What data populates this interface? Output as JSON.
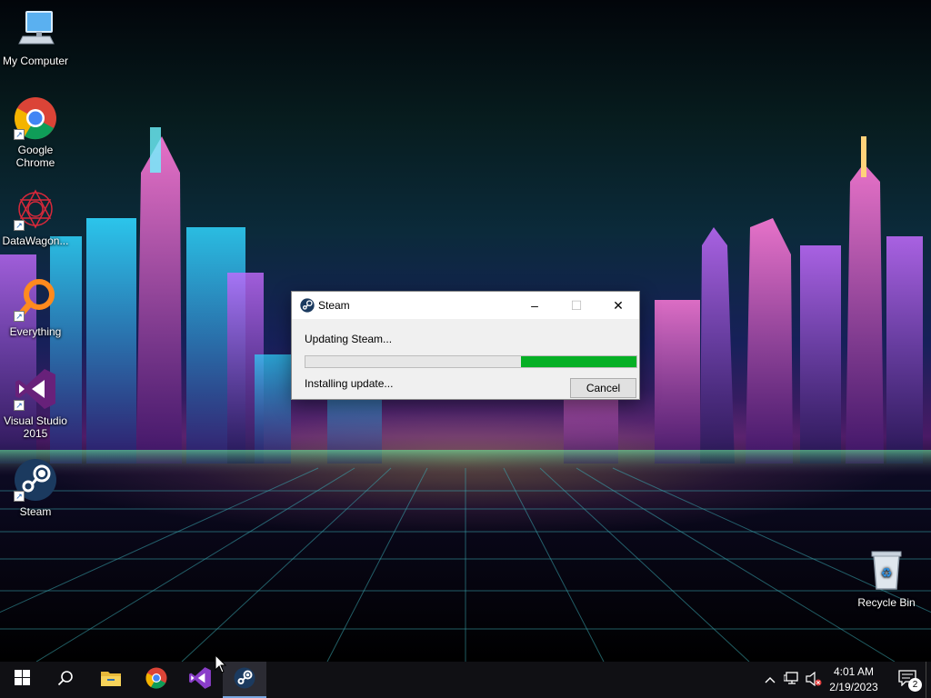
{
  "desktop": {
    "icons": [
      {
        "label": "My Computer",
        "icon": "computer-icon"
      },
      {
        "label": "Google Chrome",
        "icon": "chrome-icon"
      },
      {
        "label": "DataWagon...",
        "icon": "datawagon-icon"
      },
      {
        "label": "Everything",
        "icon": "search-magnifier-icon"
      },
      {
        "label": "Visual Studio 2015",
        "icon": "visual-studio-icon"
      },
      {
        "label": "Steam",
        "icon": "steam-icon"
      },
      {
        "label": "Recycle Bin",
        "icon": "recycle-bin-icon"
      }
    ]
  },
  "dialog": {
    "title": "Steam",
    "status": "Updating Steam...",
    "progress": 0.35,
    "substatus": "Installing update...",
    "cancel_label": "Cancel",
    "minimize_glyph": "–",
    "maximize_glyph": "☐",
    "close_glyph": "✕"
  },
  "taskbar": {
    "apps": [
      {
        "name": "start",
        "icon": "windows-logo-icon"
      },
      {
        "name": "search",
        "icon": "search-icon"
      },
      {
        "name": "file-explorer",
        "icon": "folder-icon"
      },
      {
        "name": "chrome",
        "icon": "chrome-icon"
      },
      {
        "name": "visual-studio",
        "icon": "visual-studio-icon"
      },
      {
        "name": "steam",
        "icon": "steam-icon",
        "active": true
      }
    ],
    "clock_time": "4:01 AM",
    "clock_date": "2/19/2023",
    "notification_count": "2"
  },
  "colors": {
    "progress_fill": "#06b025",
    "taskbar_bg": "#101014",
    "active_indicator": "#7aa7e0"
  }
}
